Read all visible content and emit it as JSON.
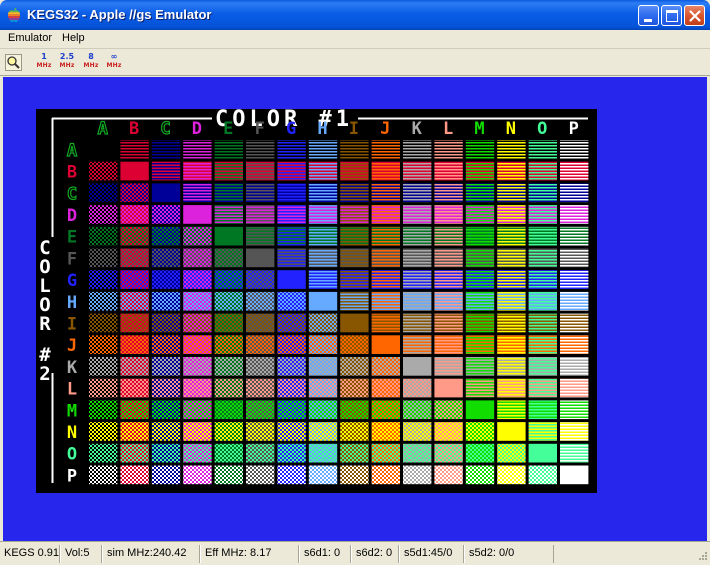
{
  "window": {
    "title": "KEGS32 - Apple //gs Emulator",
    "icon": "apple-rainbow-icon",
    "controls": [
      "minimize-icon",
      "maximize-icon",
      "close-icon"
    ]
  },
  "menu": {
    "items": [
      {
        "label": "Emulator"
      },
      {
        "label": "Help"
      }
    ]
  },
  "toolbar": {
    "zoom_icon": "magnifier-icon",
    "speeds": [
      {
        "value": "1",
        "unit": "MHz"
      },
      {
        "value": "2.5",
        "unit": "MHz"
      },
      {
        "value": "8",
        "unit": "MHz"
      },
      {
        "value": "∞",
        "unit": "MHz"
      }
    ]
  },
  "screen": {
    "title": "COLOR #1",
    "side_label": "COLOR #2",
    "letters": [
      "A",
      "B",
      "C",
      "D",
      "E",
      "F",
      "G",
      "H",
      "I",
      "J",
      "K",
      "L",
      "M",
      "N",
      "O",
      "P"
    ],
    "palette": [
      "#000000",
      "#DD0033",
      "#000099",
      "#DD22DD",
      "#007722",
      "#555555",
      "#2222FF",
      "#66AAFF",
      "#885500",
      "#FF6600",
      "#AAAAAA",
      "#FF9988",
      "#11DD00",
      "#FFFF00",
      "#44FF99",
      "#FFFFFF"
    ],
    "background": "#000000",
    "border_color": "#FFFFFF"
  },
  "colors": {
    "titlebar": "#0553D8",
    "client_background": "#2626EC",
    "chrome": "#ECE9D8"
  },
  "status": [
    {
      "text": "KEGS 0.91"
    },
    {
      "text": "Vol:5"
    },
    {
      "text": "sim MHz:240.42"
    },
    {
      "text": "Eff MHz:  8.17"
    },
    {
      "text": "s6d1: 0"
    },
    {
      "text": "s6d2: 0"
    },
    {
      "text": "s5d1:45/0"
    },
    {
      "text": "s5d2: 0/0"
    }
  ]
}
